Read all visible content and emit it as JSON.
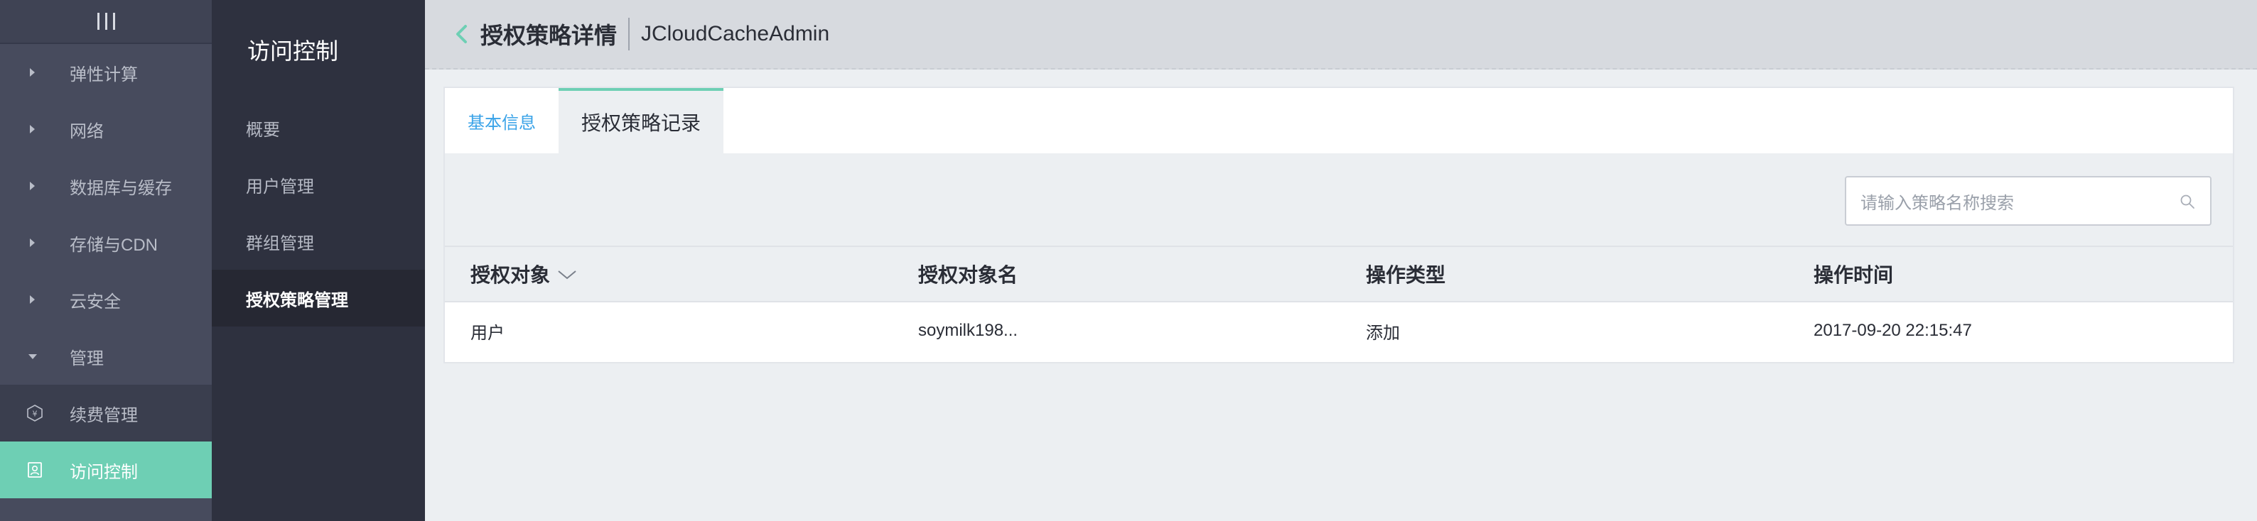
{
  "main_nav": {
    "items": [
      {
        "label": "弹性计算",
        "expanded": false
      },
      {
        "label": "网络",
        "expanded": false
      },
      {
        "label": "数据库与缓存",
        "expanded": false
      },
      {
        "label": "存储与CDN",
        "expanded": false
      },
      {
        "label": "云安全",
        "expanded": false
      },
      {
        "label": "管理",
        "expanded": true
      }
    ],
    "sub_items": [
      {
        "label": "续费管理",
        "icon": "yen-icon"
      },
      {
        "label": "访问控制",
        "icon": "user-card-icon",
        "active": true
      }
    ]
  },
  "sub_nav": {
    "title": "访问控制",
    "items": [
      "概要",
      "用户管理",
      "群组管理",
      "授权策略管理"
    ],
    "active_index": 3
  },
  "header": {
    "title": "授权策略详情",
    "subtitle": "JCloudCacheAdmin"
  },
  "tabs": [
    {
      "label": "基本信息",
      "active": false
    },
    {
      "label": "授权策略记录",
      "active": true
    }
  ],
  "search": {
    "placeholder": "请输入策略名称搜索"
  },
  "table": {
    "columns": [
      "授权对象",
      "授权对象名",
      "操作类型",
      "操作时间"
    ],
    "rows": [
      [
        "用户",
        "soymilk198...",
        "添加",
        "2017-09-20 22:15:47"
      ]
    ]
  },
  "colors": {
    "accent": "#6ecfb4",
    "link": "#3aa3e8",
    "nav_bg": "#474b5d",
    "subnav_bg": "#2e313f"
  }
}
